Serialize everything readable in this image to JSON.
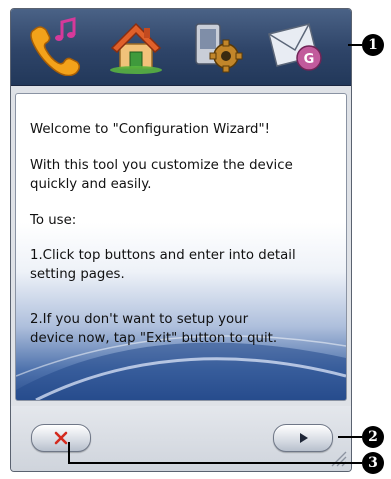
{
  "toolbar": {
    "buttons": [
      {
        "name": "phone-music-button",
        "icon": "phone-music-icon"
      },
      {
        "name": "home-button",
        "icon": "home-icon"
      },
      {
        "name": "device-settings-button",
        "icon": "device-settings-icon"
      },
      {
        "name": "mail-button",
        "icon": "mail-icon"
      }
    ]
  },
  "content": {
    "welcome": "Welcome to \"Configuration Wizard\"!",
    "intro": "With this tool you customize the device\nquickly and easily.",
    "to_use": "To use:",
    "step1": "1.Click top buttons and enter into detail\nsetting pages.",
    "step2": "2.If you don't want to setup your\ndevice now, tap \"Exit\" button to quit."
  },
  "buttons": {
    "exit_icon": "close-x-icon",
    "next_icon": "play-arrow-icon"
  },
  "callouts": [
    "1",
    "2",
    "3"
  ],
  "colors": {
    "toolbar": "#2e4468",
    "exit_x": "#d42a1e",
    "content_gradient_bottom": "#2a4e8e"
  }
}
